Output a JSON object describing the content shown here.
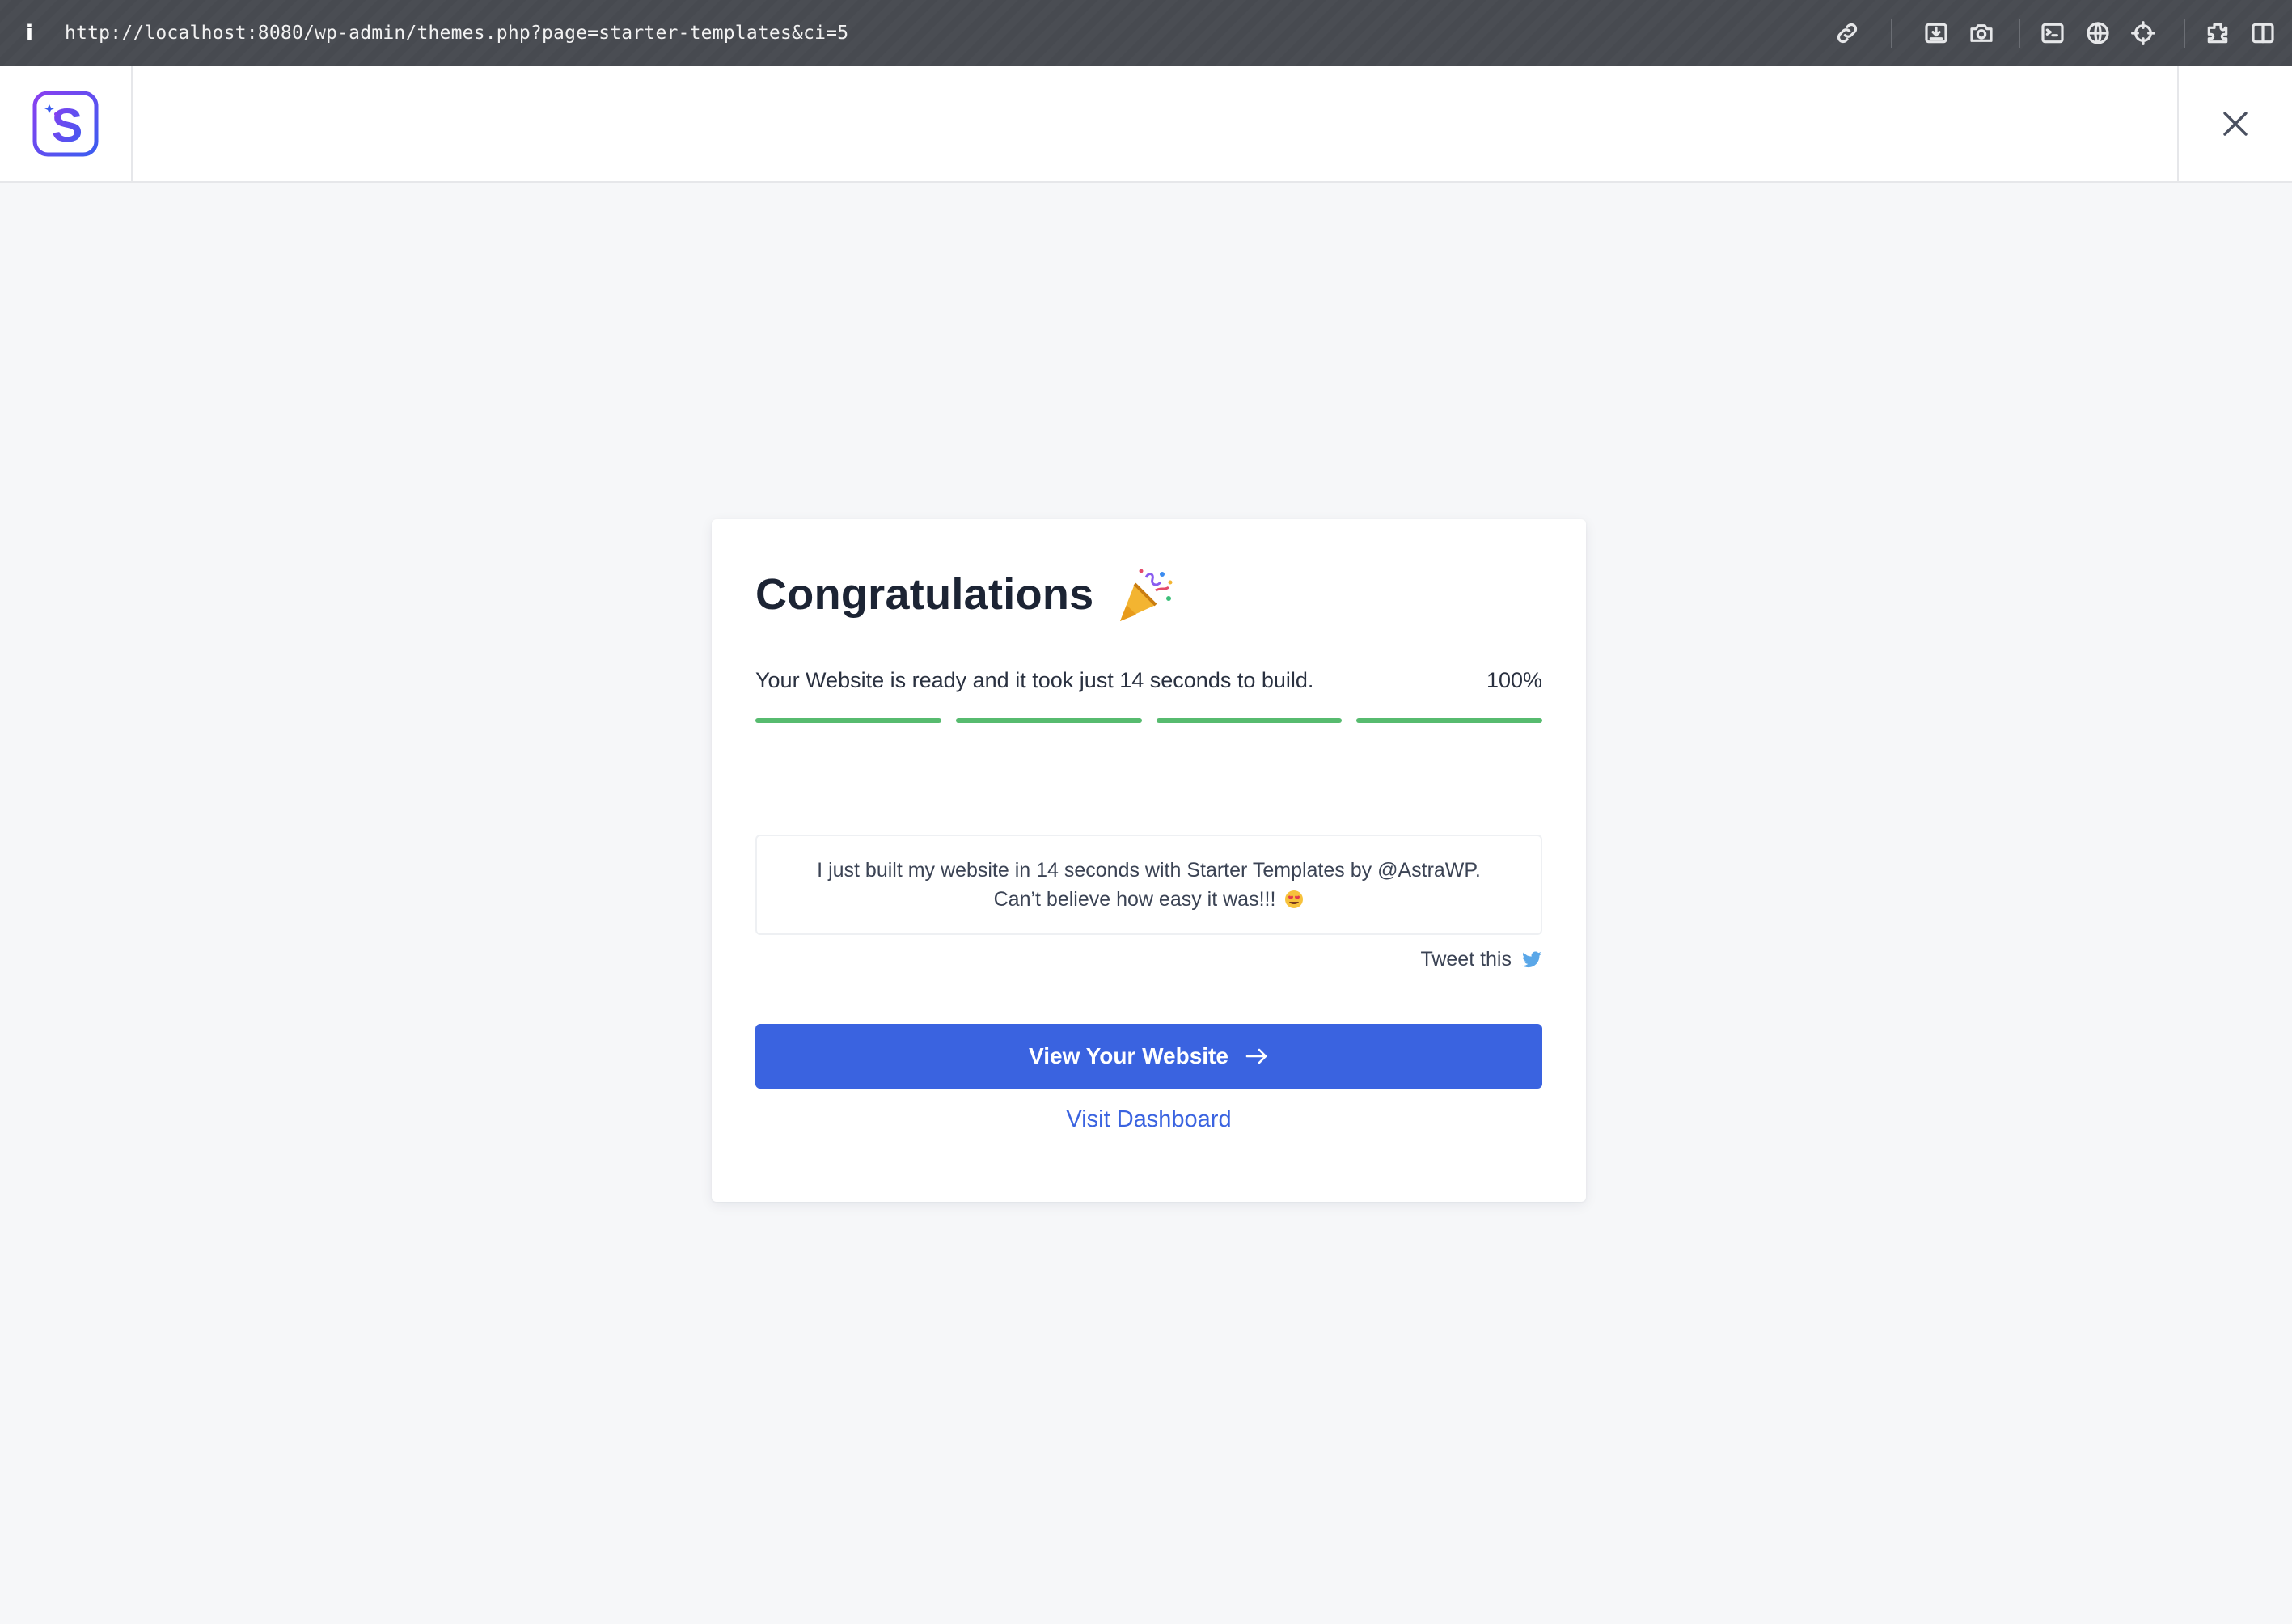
{
  "browser": {
    "info_icon": "info-icon",
    "url": "http://localhost:8080/wp-admin/themes.php?page=starter-templates&ci=5",
    "tools": [
      "link-icon",
      "download-icon",
      "camera-icon",
      "terminal-icon",
      "globe-icon",
      "crosshair-icon",
      "extensions-icon",
      "sidebar-icon"
    ]
  },
  "header": {
    "logo_icon": "starter-templates-logo-icon",
    "close_icon": "close-icon"
  },
  "card": {
    "title": "Congratulations",
    "title_icon": "party-popper-icon",
    "status_text": "Your Website is ready and it took just 14 seconds to build.",
    "progress_percent": "100%",
    "progress": {
      "segments": 4,
      "fraction": 1.0,
      "color": "#57bb6f"
    },
    "tweet_line1": "I just built my website in 14 seconds with Starter Templates by @AstraWP.",
    "tweet_line2": "Can’t believe how easy it was!!!",
    "tweet_emoji": "heart-eyes-emoji-icon",
    "tweet_link": "Tweet this",
    "tweet_icon": "twitter-bird-icon",
    "view_button": "View Your Website",
    "view_button_icon": "arrow-right-icon",
    "dashboard_link": "Visit Dashboard"
  },
  "colors": {
    "accent": "#3a63e0",
    "success": "#57bb6f",
    "background": "#f6f7f9",
    "twitter": "#5aa7e8",
    "logo_gradient": [
      "#7a3df0",
      "#3b5df0"
    ]
  }
}
